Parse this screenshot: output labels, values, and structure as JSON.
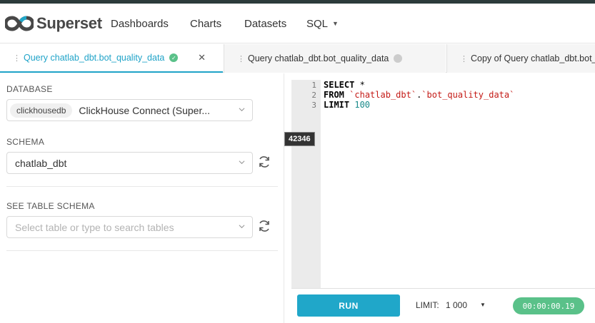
{
  "app": {
    "brand": "Superset"
  },
  "nav": {
    "dashboards": "Dashboards",
    "charts": "Charts",
    "datasets": "Datasets",
    "sql": "SQL"
  },
  "tabs": [
    {
      "label": "Query chatlab_dbt.bot_quality_data",
      "status": "success",
      "close": "✕"
    },
    {
      "label": "Query chatlab_dbt.bot_quality_data",
      "status": "idle"
    },
    {
      "label": "Copy of Query chatlab_dbt.bot_quality_data"
    }
  ],
  "left": {
    "database_label": "DATABASE",
    "database_chip": "clickhousedb",
    "database_value": "ClickHouse Connect (Super...",
    "schema_label": "SCHEMA",
    "schema_value": "chatlab_dbt",
    "table_label": "SEE TABLE SCHEMA",
    "table_placeholder": "Select table or type to search tables"
  },
  "editor": {
    "line_numbers": [
      "1",
      "2",
      "3"
    ],
    "line1_kw": "SELECT",
    "line1_rest": " *",
    "line2_kw": "FROM",
    "line2_str1": "`chatlab_dbt`",
    "line2_dot": ".",
    "line2_str2": "`bot_quality_data`",
    "line3_kw": "LIMIT",
    "line3_num": "100",
    "tooltip": "42346"
  },
  "bottom": {
    "run": "RUN",
    "limit_label": "LIMIT:",
    "limit_value": "1 000",
    "timer": "00:00:00.19"
  },
  "colors": {
    "accent": "#20a7c9",
    "success": "#5ac189",
    "string": "#c41a16",
    "number": "#1a8a8a"
  }
}
